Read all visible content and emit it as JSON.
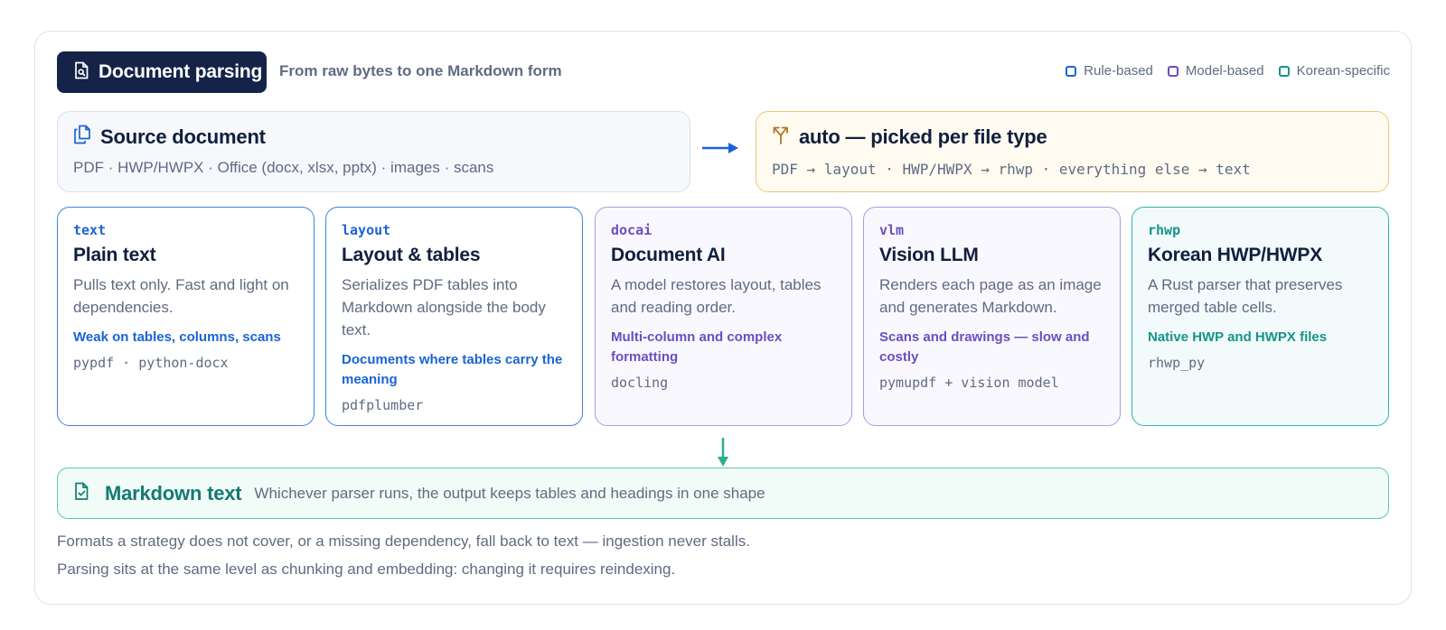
{
  "header": {
    "title": "Document parsing",
    "subtitle": "From raw bytes to one Markdown form",
    "legend": [
      {
        "label": "Rule-based",
        "color": "#1a63d6"
      },
      {
        "label": "Model-based",
        "color": "#6a4fbf"
      },
      {
        "label": "Korean-specific",
        "color": "#15948a"
      }
    ]
  },
  "source": {
    "title": "Source document",
    "formats": "PDF · HWP/HWPX · Office (docx, xlsx, pptx) · images · scans"
  },
  "auto": {
    "title": "auto — picked per file type",
    "rule": "PDF → layout · HWP/HWPX → rhwp · everything else → text"
  },
  "parsers": [
    {
      "code": "text",
      "name": "Plain text",
      "desc": "Pulls text only. Fast and light on dependencies.",
      "best": "Weak on tables, columns, scans",
      "deps": "pypdf · python-docx",
      "kind": "Rule-based"
    },
    {
      "code": "layout",
      "name": "Layout & tables",
      "desc": "Serializes PDF tables into Markdown alongside the body text.",
      "best": "Documents where tables carry the meaning",
      "deps": "pdfplumber",
      "kind": "Rule-based"
    },
    {
      "code": "docai",
      "name": "Document AI",
      "desc": "A model restores layout, tables and reading order.",
      "best": "Multi-column and complex formatting",
      "deps": "docling",
      "kind": "Model-based"
    },
    {
      "code": "vlm",
      "name": "Vision LLM",
      "desc": "Renders each page as an image and generates Markdown.",
      "best": "Scans and drawings — slow and costly",
      "deps": "pymupdf + vision model",
      "kind": "Model-based"
    },
    {
      "code": "rhwp",
      "name": "Korean HWP/HWPX",
      "desc": "A Rust parser that preserves merged table cells.",
      "best": "Native HWP and HWPX files",
      "deps": "rhwp_py",
      "kind": "Korean-specific"
    }
  ],
  "output": {
    "title": "Markdown text",
    "desc": "Whichever parser runs, the output keeps tables and headings in one shape"
  },
  "notes": [
    "Formats a strategy does not cover, or a missing dependency, fall back to text — ingestion never stalls.",
    "Parsing sits at the same level as chunking and embedding: changing it requires reindexing."
  ],
  "icons": {
    "title": "file-search-icon",
    "source": "copy-files-icon",
    "auto": "split-arrow-icon",
    "output": "file-check-icon"
  }
}
